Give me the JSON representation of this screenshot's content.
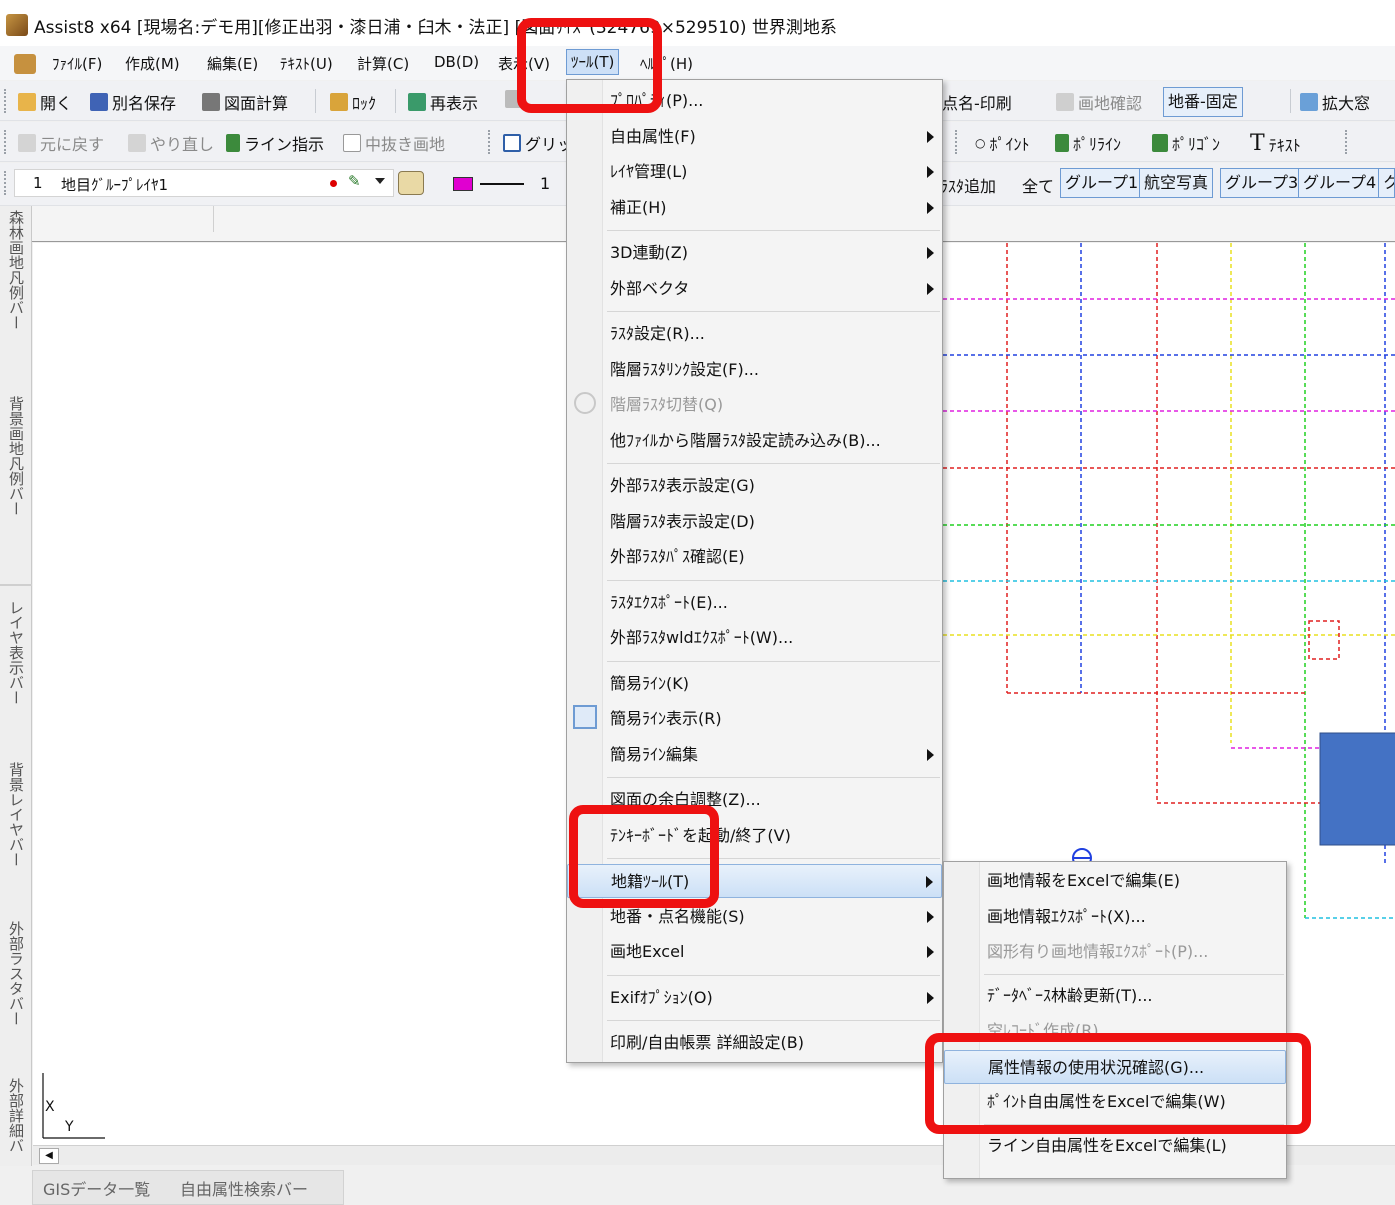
{
  "window": {
    "title": "Assist8 x64 [現場名:デモ用][修正出羽・漆日浦・臼木・法正] [図面ｻｲｽﾞ(324769×529510) 世界測地系"
  },
  "menubar": [
    "ﾌｧｲﾙ(F)",
    "作成(M)",
    "編集(E)",
    "ﾃｷｽﾄ(U)",
    "計算(C)",
    "DB(D)",
    "表示(V)",
    "ﾂｰﾙ(T)",
    "ﾍﾙﾌﾟ(H)"
  ],
  "toolbar1": {
    "open": "開く",
    "saveas": "別名保存",
    "area_calc": "図面計算",
    "lock": "ﾛｯｸ",
    "redraw": "再表示",
    "point_print": "点名-印刷",
    "parcel_check": "画地確認",
    "lot_fixed": "地番-固定",
    "zoom_window": "拡大窓"
  },
  "toolbar2": {
    "undo": "元に戻す",
    "redo": "やり直し",
    "line_instruct": "ライン指示",
    "hollow_parcel": "中抜き画地",
    "grid": "グリッ",
    "point": "ﾎﾟｲﾝﾄ",
    "polyline": "ﾎﾟﾘﾗｲﾝ",
    "polygon": "ﾎﾟﾘｺﾞﾝ",
    "text": "ﾃｷｽﾄ"
  },
  "toolbar3": {
    "layer_number": "1",
    "layer_name": "地目ｸﾞﾙｰﾌﾟﾚｲﾔ1",
    "line_width": "1",
    "raster_add": "ﾗｽﾀ追加",
    "tabs": [
      "全て",
      "グループ1",
      "航空写真",
      "グループ3",
      "グループ4"
    ]
  },
  "left_panels": [
    "森林画地凡例バー",
    "背景画地凡例バー",
    "レイヤ表示バー",
    "背景レイヤバー",
    "外部ラスタバー",
    "外部詳細バ"
  ],
  "axis": {
    "x": "X",
    "y": "Y"
  },
  "bottom_tabs": [
    "GISデータ一覧",
    "自由属性検索バー"
  ],
  "tools_menu": [
    {
      "label": "ﾌﾟﾛﾊﾟﾃｨ(P)...",
      "sub": false
    },
    {
      "label": "自由属性(F)",
      "sub": true
    },
    {
      "label": "ﾚｲﾔ管理(L)",
      "sub": true
    },
    {
      "label": "補正(H)",
      "sub": true
    },
    {
      "sep": true
    },
    {
      "label": "3D連動(Z)",
      "sub": true
    },
    {
      "label": "外部ベクタ",
      "sub": true
    },
    {
      "sep": true
    },
    {
      "label": "ﾗｽﾀ設定(R)...",
      "sub": false
    },
    {
      "label": "階層ﾗｽﾀﾘﾝｸ設定(F)...",
      "sub": false
    },
    {
      "label": "階層ﾗｽﾀ切替(Q)",
      "sub": false,
      "disabled": true
    },
    {
      "label": "他ﾌｧｲﾙから階層ﾗｽﾀ設定読み込み(B)...",
      "sub": false
    },
    {
      "sep": true
    },
    {
      "label": "外部ﾗｽﾀ表示設定(G)",
      "sub": false
    },
    {
      "label": "階層ﾗｽﾀ表示設定(D)",
      "sub": false
    },
    {
      "label": "外部ﾗｽﾀﾊﾟｽ確認(E)",
      "sub": false
    },
    {
      "sep": true
    },
    {
      "label": "ﾗｽﾀｴｸｽﾎﾟｰﾄ(E)...",
      "sub": false
    },
    {
      "label": "外部ﾗｽﾀwldｴｸｽﾎﾟｰﾄ(W)...",
      "sub": false
    },
    {
      "sep": true
    },
    {
      "label": "簡易ﾗｲﾝ(K)",
      "sub": false
    },
    {
      "label": "簡易ﾗｲﾝ表示(R)",
      "sub": false
    },
    {
      "label": "簡易ﾗｲﾝ編集",
      "sub": true
    },
    {
      "sep": true
    },
    {
      "label": "図面の余白調整(Z)...",
      "sub": false
    },
    {
      "label": "ﾃﾝｷｰﾎﾞｰﾄﾞを起動/終了(V)",
      "sub": false
    },
    {
      "sep": true
    },
    {
      "label": "地籍ﾂｰﾙ(T)",
      "sub": true,
      "highlight": true
    },
    {
      "label": "地番・点名機能(S)",
      "sub": true
    },
    {
      "label": "画地Excel",
      "sub": true
    },
    {
      "sep": true
    },
    {
      "label": "Exifｵﾌﾟｼｮﾝ(O)",
      "sub": true
    },
    {
      "sep": true
    },
    {
      "label": "印刷/自由帳票 詳細設定(B)",
      "sub": false
    }
  ],
  "cadastral_submenu": [
    {
      "label": "画地情報をExcelで編集(E)"
    },
    {
      "label": "画地情報ｴｸｽﾎﾟｰﾄ(X)..."
    },
    {
      "label": "図形有り画地情報ｴｸｽﾎﾟｰﾄ(P)...",
      "disabled": true
    },
    {
      "sep": true
    },
    {
      "label": "ﾃﾞｰﾀﾍﾞｰｽ林齢更新(T)..."
    },
    {
      "label": "空ﾚｺｰﾄﾞ作成(R)...",
      "disabled": true
    },
    {
      "label": "属性情報の使用状況確認(G)...",
      "highlight": true
    },
    {
      "label": "ﾎﾟｲﾝﾄ自由属性をExcelで編集(W)"
    },
    {
      "sep": true
    },
    {
      "label": "ライン自由属性をExcelで編集(L)"
    }
  ],
  "colors": {
    "highlight_box": "#ee1111",
    "accent": "#6e9bd3",
    "blue_block": "#4472c4"
  }
}
